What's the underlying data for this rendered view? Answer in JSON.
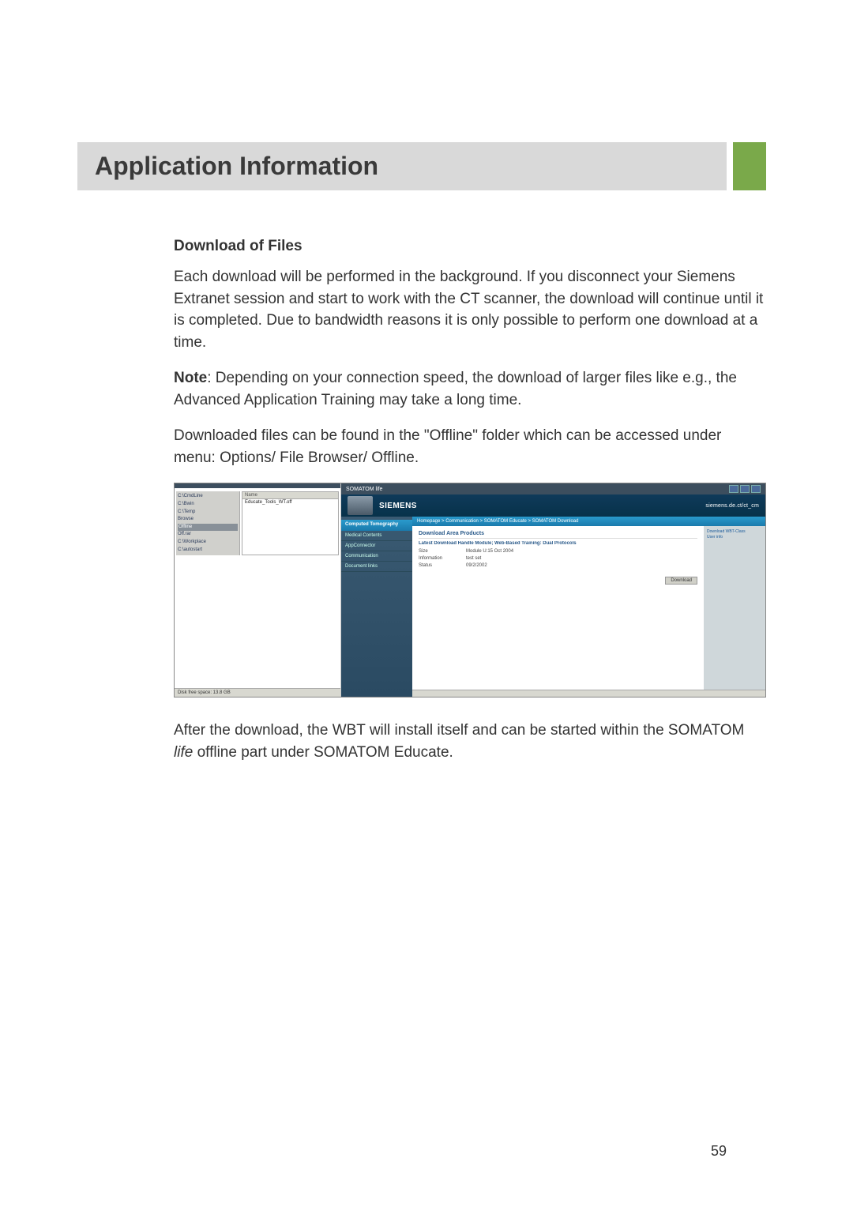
{
  "header": {
    "title": "Application Information"
  },
  "section": {
    "heading": "Download of Files",
    "p1": "Each download will be performed in the background. If you disconnect your Siemens Extranet session and start to work with the CT scanner, the download will continue until it is completed. Due to bandwidth reasons it is only possible to perform one download at a time.",
    "note_label": "Note",
    "p2": ": Depending on your connection speed, the download of larger files like e.g., the Advanced Application Training may take a long time.",
    "p3": "Downloaded files can be found in the \"Offline\" folder which can be accessed under menu: Options/ File Browser/ Offline.",
    "p4_a": "After the download, the WBT will install itself and can be started within the SOMATOM ",
    "p4_i": "life",
    "p4_b": " offline part under SOMATOM Educate."
  },
  "screenshot": {
    "tree": {
      "items": [
        "C:\\CmdLine",
        "C:\\Bwin",
        "C:\\Temp",
        "Browse",
        "Offline",
        "Off.rar",
        "C:\\Workplace",
        "C:\\autostart"
      ],
      "selected": "Offline",
      "header": "Name",
      "file": "Educate_Tools_WT.off"
    },
    "status": "Disk free space: 13.8 GB",
    "window_title": "SOMATOM life",
    "brand": "SIEMENS",
    "tagline": "siemens.de.ct/ct_cm",
    "nav": {
      "head": "Computed Tomography",
      "items": [
        "Medical Contents",
        "AppConnector",
        "Communication",
        "Document links"
      ]
    },
    "breadcrumb": "Homepage > Communication > SOMATOM Educate > SOMATOM Download",
    "content": {
      "title": "Download Area Products",
      "desc": "Latest Download Handle Module; Web-Based Training: Dual Protocols",
      "kv": [
        {
          "k": "Size",
          "v": "Module U:15 Oct 2004"
        },
        {
          "k": "Information",
          "v": "test set"
        },
        {
          "k": "Status",
          "v": "09/2/2002"
        }
      ],
      "button": "Download"
    },
    "sidebar": {
      "link1": "Download WBT-Class",
      "link2": "User info"
    }
  },
  "page_number": "59"
}
